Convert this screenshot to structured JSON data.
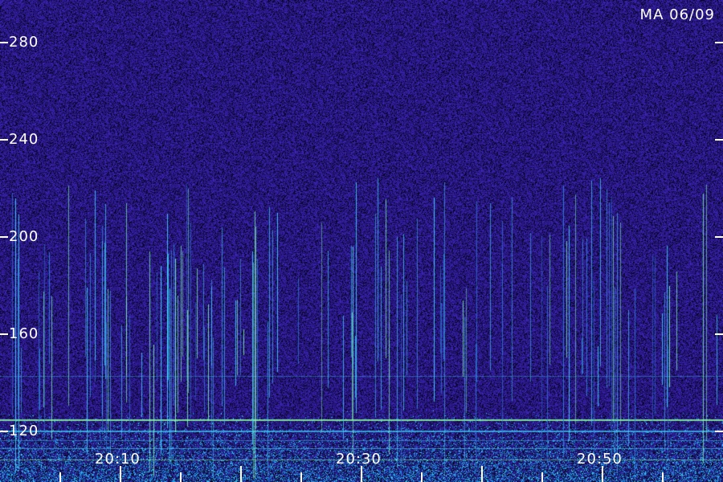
{
  "header": {
    "station_date": "MA 06/09"
  },
  "y_axis": {
    "ticks": [
      {
        "value": 280,
        "label": "280"
      },
      {
        "value": 240,
        "label": "240"
      },
      {
        "value": 200,
        "label": "200"
      },
      {
        "value": 160,
        "label": "160"
      },
      {
        "value": 120,
        "label": "120"
      }
    ],
    "range": [
      107,
      297
    ]
  },
  "x_axis": {
    "labels": [
      "20:10",
      "20:30",
      "20:50"
    ]
  },
  "colors": {
    "background_noise": "#2a1a8a",
    "background_dark": "#0a0840",
    "meteor_cyan": "#3fd6ff",
    "meteor_green": "#7dffb0",
    "band_green": "#8affa0",
    "text": "#ffffff"
  }
}
